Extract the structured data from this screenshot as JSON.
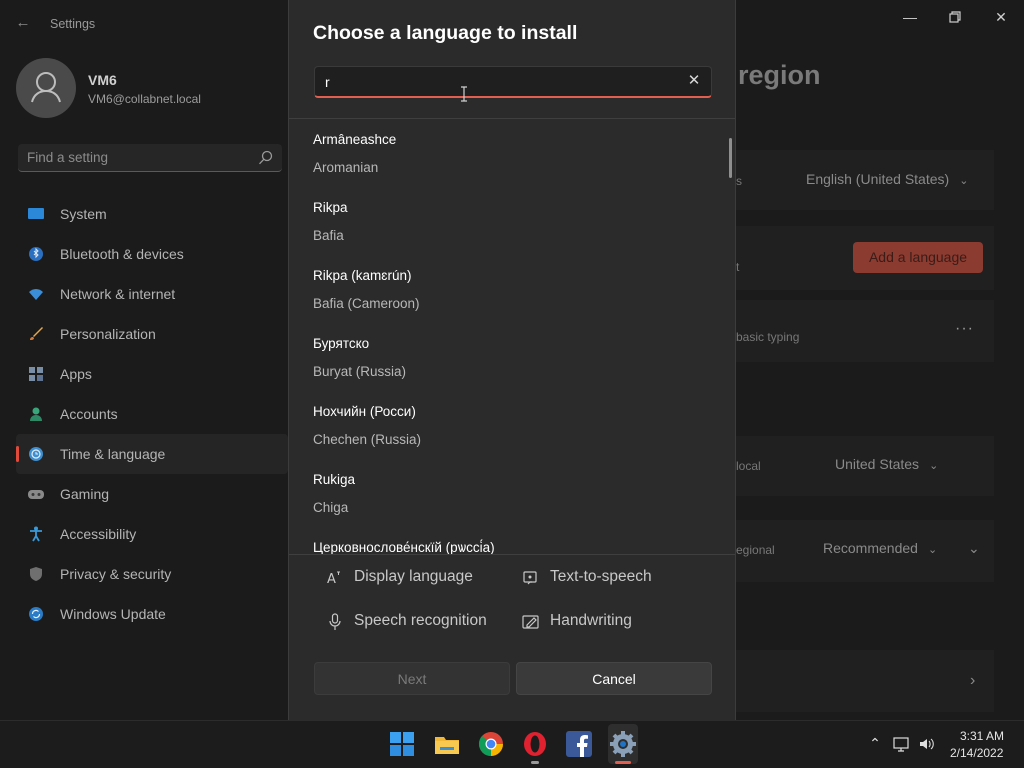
{
  "window": {
    "app_title": "Settings",
    "page_title_fragment": "region"
  },
  "profile": {
    "name": "VM6",
    "email": "VM6@collabnet.local"
  },
  "search": {
    "placeholder": "Find a setting"
  },
  "sidebar": {
    "items": [
      {
        "label": "System",
        "icon": "system-icon"
      },
      {
        "label": "Bluetooth & devices",
        "icon": "bluetooth-icon"
      },
      {
        "label": "Network & internet",
        "icon": "wifi-icon"
      },
      {
        "label": "Personalization",
        "icon": "brush-icon"
      },
      {
        "label": "Apps",
        "icon": "apps-icon"
      },
      {
        "label": "Accounts",
        "icon": "accounts-icon"
      },
      {
        "label": "Time & language",
        "icon": "clock-globe-icon",
        "active": true
      },
      {
        "label": "Gaming",
        "icon": "gaming-icon"
      },
      {
        "label": "Accessibility",
        "icon": "accessibility-icon"
      },
      {
        "label": "Privacy & security",
        "icon": "shield-icon"
      },
      {
        "label": "Windows Update",
        "icon": "update-icon"
      }
    ]
  },
  "background": {
    "windows_display_language_fragment": "s",
    "windows_display_language_value": "English (United States)",
    "preferred_languages_fragment": "t",
    "add_language_label": "Add a language",
    "english_fragment": "basic typing",
    "country_fragment": "local",
    "country_value": "United States",
    "regional_format_fragment": "egional",
    "regional_format_value": "Recommended"
  },
  "dialog": {
    "title": "Choose a language to install",
    "search_value": "r",
    "languages": [
      {
        "native": "Armâneashce",
        "english": "Aromanian"
      },
      {
        "native": "Rikpa",
        "english": "Bafia"
      },
      {
        "native": "Rikpa (kamɛrún)",
        "english": "Bafia (Cameroon)"
      },
      {
        "native": "Бурятско",
        "english": "Buryat (Russia)"
      },
      {
        "native": "Нохчийн (Росси)",
        "english": "Chechen (Russia)"
      },
      {
        "native": "Rukiga",
        "english": "Chiga"
      },
      {
        "native": "Церковнослове́нскїй (рѡссі́а)",
        "english": ""
      }
    ],
    "features": {
      "display_language": "Display language",
      "text_to_speech": "Text-to-speech",
      "speech_recognition": "Speech recognition",
      "handwriting": "Handwriting"
    },
    "next_label": "Next",
    "cancel_label": "Cancel"
  },
  "taskbar": {
    "apps": [
      "windows-start-icon",
      "file-explorer-icon",
      "chrome-icon",
      "opera-icon",
      "facebook-icon",
      "settings-gear-icon"
    ],
    "time": "3:31 AM",
    "date": "2/14/2022"
  },
  "colors": {
    "accent": "#e05f50",
    "dialog_bg": "#2b2b2b",
    "window_bg": "#1b1b1b",
    "taskbar_bg": "#1c1c1c"
  }
}
